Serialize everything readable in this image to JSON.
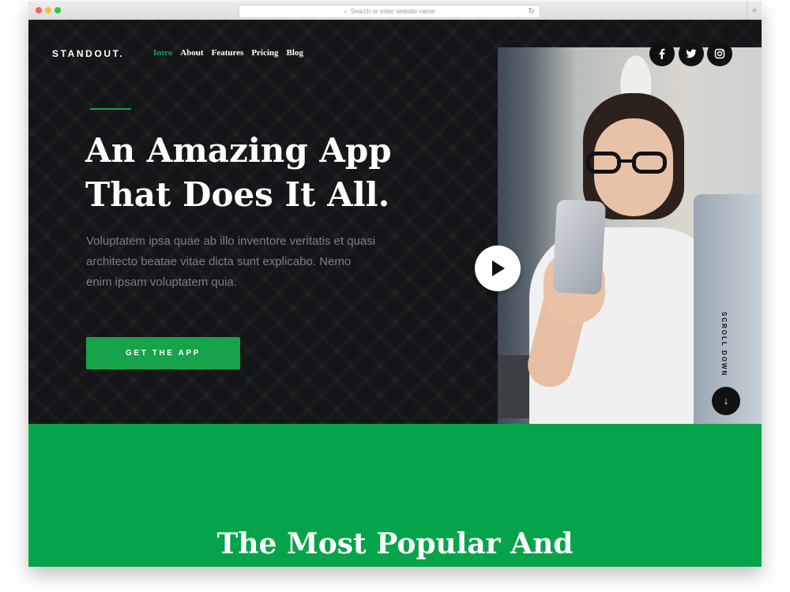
{
  "browser": {
    "address_placeholder": "Search or enter website name",
    "newtab_symbol": "+"
  },
  "site": {
    "logo": "STANDOUT.",
    "nav": [
      "Intro",
      "About",
      "Features",
      "Pricing",
      "Blog"
    ],
    "active_nav": "Intro",
    "accent_color": "#16a34a"
  },
  "hero": {
    "headline_lines": [
      "An Amazing App",
      "That Does It All."
    ],
    "paragraph": "Voluptatem ipsa quae ab illo inventore veritatis et quasi architecto beatae vitae dicta sunt explicabo. Nemo enim ipsam voluptatem quia.",
    "cta_label": "GET THE APP",
    "scroll_label": "SCROLL DOWN",
    "scroll_arrow": "↓"
  },
  "social_icons": [
    "facebook-icon",
    "twitter-icon",
    "instagram-icon"
  ],
  "section": {
    "heading": "The Most Popular And"
  }
}
